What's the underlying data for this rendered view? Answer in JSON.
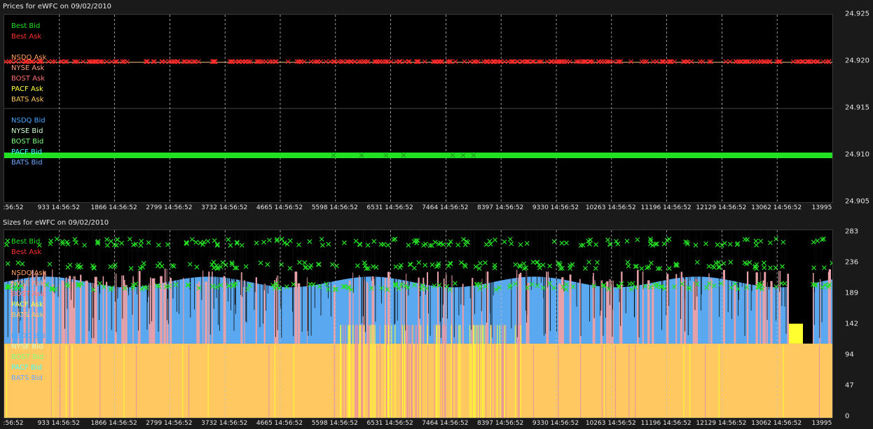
{
  "top_panel": {
    "title": "Prices for  eWFC  on  09/02/2010"
  },
  "bottom_panel": {
    "title": "Sizes for  eWFC  on  09/02/2010"
  },
  "legend": [
    {
      "label": "Best Bid",
      "color": "#22e022"
    },
    {
      "label": "Best Ask",
      "color": "#ff3030"
    },
    {
      "label": "NSDQ Ask",
      "color": "#ffa060"
    },
    {
      "label": "NYSE Ask",
      "color": "#ff9f80"
    },
    {
      "label": "BOST Ask",
      "color": "#ff7070"
    },
    {
      "label": "PACF Ask",
      "color": "#ffff40"
    },
    {
      "label": "BATS Ask",
      "color": "#ffc860"
    },
    {
      "label": "NSDQ Bid",
      "color": "#4aa6ff"
    },
    {
      "label": "NYSE Bid",
      "color": "#d0ffd0"
    },
    {
      "label": "BOST Bid",
      "color": "#80ff80"
    },
    {
      "label": "PACF Bid",
      "color": "#40ffff"
    },
    {
      "label": "BATS Bid",
      "color": "#70a8ff"
    }
  ],
  "chart_data": [
    {
      "type": "scatter",
      "title": "Prices for  eWFC  on  09/02/2010",
      "x_tick_labels": [
        ":56:52",
        "933 14:56:52",
        "1866 14:56:52",
        "2799 14:56:52",
        "3732 14:56:52",
        "4665 14:56:52",
        "5598 14:56:52",
        "6531 14:56:52",
        "7464 14:56:52",
        "8397 14:56:52",
        "9330 14:56:52",
        "10263 14:56:52",
        "11196 14:56:52",
        "12129 14:56:52",
        "13062 14:56:52",
        "13995"
      ],
      "y_tick_labels": [
        "24.925",
        "24.920",
        "24.915",
        "24.910",
        "24.905"
      ],
      "ylim": [
        24.905,
        24.925
      ],
      "xlim": [
        0,
        13995
      ],
      "series": [
        {
          "name": "Best Ask",
          "level": 24.92,
          "color": "#ff3030"
        },
        {
          "name": "Best Bid",
          "level": 24.91,
          "color": "#22e022"
        }
      ]
    },
    {
      "type": "area",
      "title": "Sizes for  eWFC  on  09/02/2010",
      "x_tick_labels": [
        ":56:52",
        "933 14:56:52",
        "1866 14:56:52",
        "2799 14:56:52",
        "3732 14:56:52",
        "4665 14:56:52",
        "5598 14:56:52",
        "6531 14:56:52",
        "7464 14:56:52",
        "8397 14:56:52",
        "9330 14:56:52",
        "10263 14:56:52",
        "11196 14:56:52",
        "12129 14:56:52",
        "13062 14:56:52",
        "13995"
      ],
      "y_tick_labels": [
        "283",
        "236",
        "189",
        "142",
        "94",
        "47",
        "0"
      ],
      "ylim": [
        0,
        283
      ],
      "xlim": [
        0,
        13995
      ],
      "series": [
        {
          "name": "BATS Ask",
          "approx_level": 112,
          "color": "#ffc860"
        },
        {
          "name": "NSDQ Bid",
          "approx_level": 200,
          "color": "#4aa6ff"
        },
        {
          "name": "Best Bid",
          "approx_level": 270,
          "color": "#22e022"
        }
      ]
    }
  ]
}
